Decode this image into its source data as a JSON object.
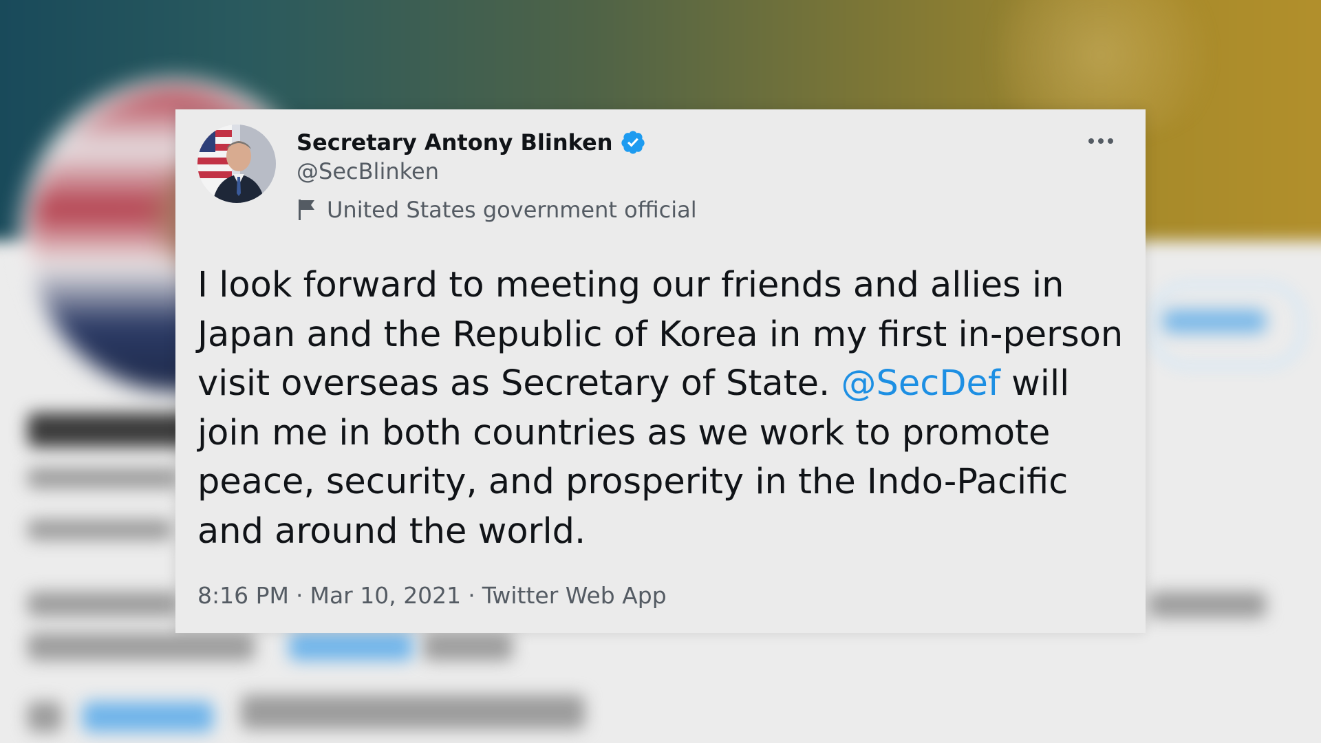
{
  "tweet": {
    "display_name": "Secretary Antony Blinken",
    "handle": "@SecBlinken",
    "affiliation": "United States government official",
    "text_before": "I look forward to meeting our friends and allies in Japan and the Republic of Korea in my first in-person visit overseas as Secretary of State. ",
    "mention": "@SecDef",
    "text_after": " will join me in both countries as we work to promote peace, security, and prosperity in the Indo-Pacific and around the world.",
    "time": "8:16 PM",
    "date": "Mar 10, 2021",
    "separator": "·",
    "source": "Twitter Web App"
  },
  "icons": {
    "verified": "verified-badge-icon",
    "affiliation": "flag-icon",
    "more": "more-options-icon"
  },
  "colors": {
    "mention": "#1d8fe3",
    "verified": "#1d9bf0",
    "secondary_text": "#545b63",
    "primary_text": "#101317"
  }
}
